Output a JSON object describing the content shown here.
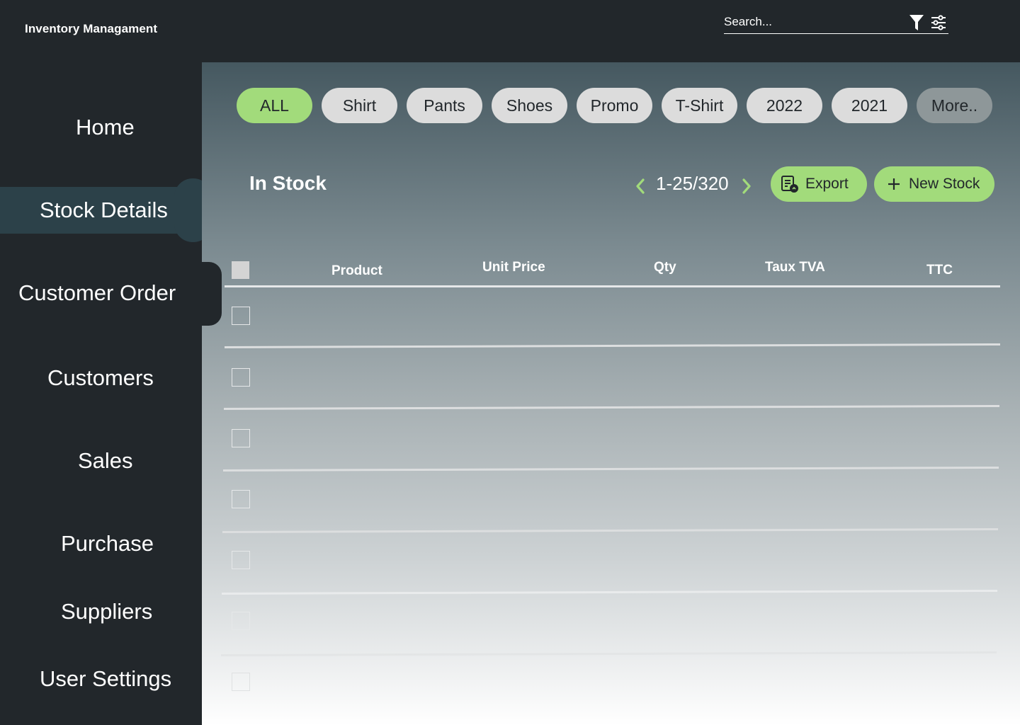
{
  "app": {
    "title": "Inventory Managament"
  },
  "search": {
    "placeholder": "Search..."
  },
  "icons": {
    "filter": "filter-funnel-icon",
    "settings": "sliders-settings-icon"
  },
  "sidebar": {
    "active": "Stock Details",
    "active_color": "#2c4149",
    "items": [
      {
        "label": "Home"
      },
      {
        "label": "Stock Details"
      },
      {
        "label": "Customer Order"
      },
      {
        "label": "Customers"
      },
      {
        "label": "Sales"
      },
      {
        "label": "Purchase"
      },
      {
        "label": "Suppliers"
      },
      {
        "label": "User Settings"
      }
    ]
  },
  "filters": {
    "selected": "ALL",
    "selected_color": "#a2db7b",
    "chips": [
      {
        "label": "ALL"
      },
      {
        "label": "Shirt"
      },
      {
        "label": "Pants"
      },
      {
        "label": "Shoes"
      },
      {
        "label": "Promo"
      },
      {
        "label": "T-Shirt"
      },
      {
        "label": "2022"
      },
      {
        "label": "2021"
      },
      {
        "label": "More.."
      }
    ]
  },
  "section": {
    "title": "In Stock"
  },
  "pagination": {
    "range": "1-25/320"
  },
  "actions": {
    "export_label": "Export",
    "new_stock_label": "New Stock",
    "accent": "#a2db7b"
  },
  "table": {
    "columns": [
      "Product",
      "Unit Price",
      "Qty",
      "Taux TVA",
      "TTC"
    ],
    "rows": [
      {},
      {},
      {},
      {},
      {},
      {},
      {}
    ]
  }
}
